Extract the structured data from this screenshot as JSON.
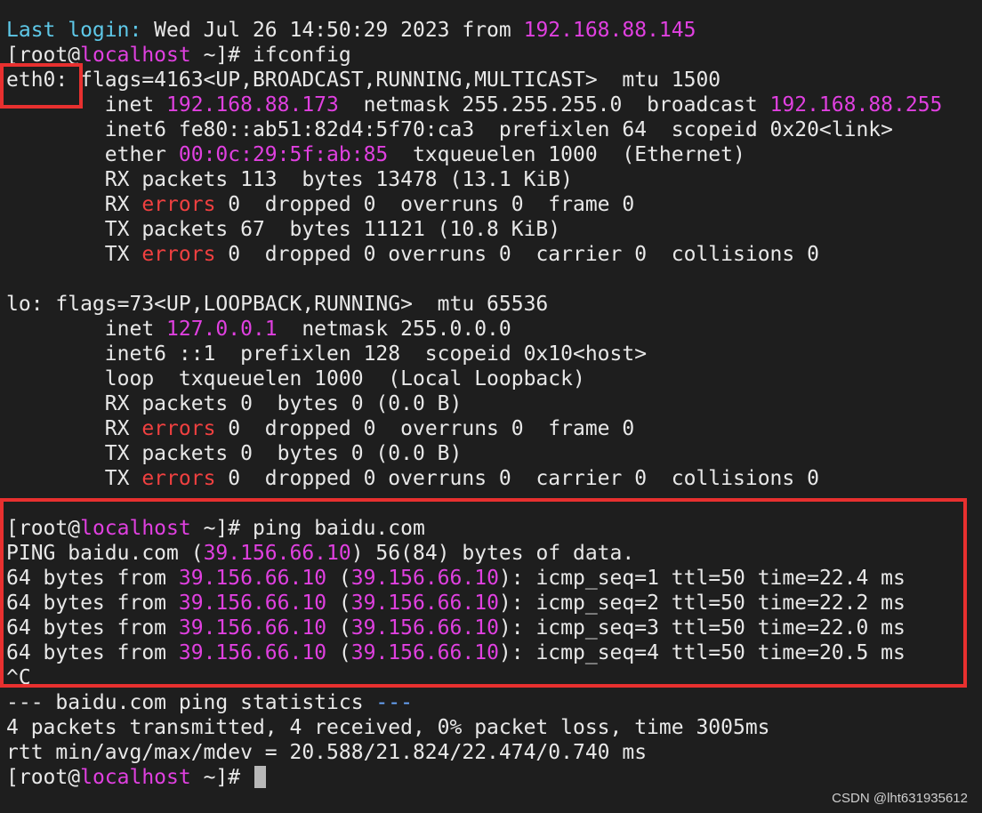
{
  "colors": {
    "background": "#1e1e1e",
    "text": "#e8e8e8",
    "cyan": "#5ec8e8",
    "magenta": "#e040e0",
    "red": "#f04040",
    "highlight_box": "#e8302f"
  },
  "terminal": {
    "lines": [
      [
        {
          "t": "Last login:",
          "c": "cyan"
        },
        {
          "t": " Wed Jul 26 14:50:29 2023 from "
        },
        {
          "t": "192.168.88.145",
          "c": "magenta"
        }
      ],
      [
        {
          "t": "[root@"
        },
        {
          "t": "localhost",
          "c": "magenta"
        },
        {
          "t": " ~]# ifconfig"
        }
      ],
      [
        {
          "t": "eth0: flags=4163<UP,BROADCAST,RUNNING,MULTICAST>  mtu 1500"
        }
      ],
      [
        {
          "t": "        inet "
        },
        {
          "t": "192.168.88.173",
          "c": "magenta"
        },
        {
          "t": "  netmask 255.255.255.0  broadcast "
        },
        {
          "t": "192.168.88.255",
          "c": "magenta"
        }
      ],
      [
        {
          "t": "        inet6 fe80::ab51:82d4:5f70:ca3  prefixlen 64  scopeid 0x20<link>"
        }
      ],
      [
        {
          "t": "        ether "
        },
        {
          "t": "00:0c:29:5f:ab:85",
          "c": "magenta"
        },
        {
          "t": "  txqueuelen 1000  (Ethernet)"
        }
      ],
      [
        {
          "t": "        RX packets 113  bytes 13478 (13.1 KiB)"
        }
      ],
      [
        {
          "t": "        RX "
        },
        {
          "t": "errors",
          "c": "red"
        },
        {
          "t": " 0  dropped 0  overruns 0  frame 0"
        }
      ],
      [
        {
          "t": "        TX packets 67  bytes 11121 (10.8 KiB)"
        }
      ],
      [
        {
          "t": "        TX "
        },
        {
          "t": "errors",
          "c": "red"
        },
        {
          "t": " 0  dropped 0 overruns 0  carrier 0  collisions 0"
        }
      ],
      [
        {
          "t": ""
        }
      ],
      [
        {
          "t": "lo: flags=73<UP,LOOPBACK,RUNNING>  mtu 65536"
        }
      ],
      [
        {
          "t": "        inet "
        },
        {
          "t": "127.0.0.1",
          "c": "magenta"
        },
        {
          "t": "  netmask 255.0.0.0"
        }
      ],
      [
        {
          "t": "        inet6 ::1  prefixlen 128  scopeid 0x10<host>"
        }
      ],
      [
        {
          "t": "        loop  txqueuelen 1000  (Local Loopback)"
        }
      ],
      [
        {
          "t": "        RX packets 0  bytes 0 (0.0 B)"
        }
      ],
      [
        {
          "t": "        RX "
        },
        {
          "t": "errors",
          "c": "red"
        },
        {
          "t": " 0  dropped 0  overruns 0  frame 0"
        }
      ],
      [
        {
          "t": "        TX packets 0  bytes 0 (0.0 B)"
        }
      ],
      [
        {
          "t": "        TX "
        },
        {
          "t": "errors",
          "c": "red"
        },
        {
          "t": " 0  dropped 0 overruns 0  carrier 0  collisions 0"
        }
      ],
      [
        {
          "t": ""
        }
      ],
      [
        {
          "t": "[root@"
        },
        {
          "t": "localhost",
          "c": "magenta"
        },
        {
          "t": " ~]# ping baidu.com"
        }
      ],
      [
        {
          "t": "PING baidu.com ("
        },
        {
          "t": "39.156.66.10",
          "c": "magenta"
        },
        {
          "t": ") 56(84) bytes of data."
        }
      ],
      [
        {
          "t": "64 bytes from "
        },
        {
          "t": "39.156.66.10",
          "c": "magenta"
        },
        {
          "t": " ("
        },
        {
          "t": "39.156.66.10",
          "c": "magenta"
        },
        {
          "t": "): icmp_seq=1 ttl=50 time=22.4 ms"
        }
      ],
      [
        {
          "t": "64 bytes from "
        },
        {
          "t": "39.156.66.10",
          "c": "magenta"
        },
        {
          "t": " ("
        },
        {
          "t": "39.156.66.10",
          "c": "magenta"
        },
        {
          "t": "): icmp_seq=2 ttl=50 time=22.2 ms"
        }
      ],
      [
        {
          "t": "64 bytes from "
        },
        {
          "t": "39.156.66.10",
          "c": "magenta"
        },
        {
          "t": " ("
        },
        {
          "t": "39.156.66.10",
          "c": "magenta"
        },
        {
          "t": "): icmp_seq=3 ttl=50 time=22.0 ms"
        }
      ],
      [
        {
          "t": "64 bytes from "
        },
        {
          "t": "39.156.66.10",
          "c": "magenta"
        },
        {
          "t": " ("
        },
        {
          "t": "39.156.66.10",
          "c": "magenta"
        },
        {
          "t": "): icmp_seq=4 ttl=50 time=20.5 ms"
        }
      ],
      [
        {
          "t": "^C"
        }
      ],
      [
        {
          "t": "--- baidu.com ping statistics "
        },
        {
          "t": "---",
          "c": "lightblue"
        }
      ],
      [
        {
          "t": "4 packets transmitted, 4 received, 0% packet loss, time 3005ms"
        }
      ],
      [
        {
          "t": "rtt min/avg/max/mdev = 20.588/21.824/22.474/0.740 ms"
        }
      ],
      [
        {
          "t": "[root@"
        },
        {
          "t": "localhost",
          "c": "magenta"
        },
        {
          "t": " ~]# "
        },
        {
          "t": "",
          "cursor": true
        }
      ]
    ]
  },
  "watermark": "CSDN @lht631935612"
}
